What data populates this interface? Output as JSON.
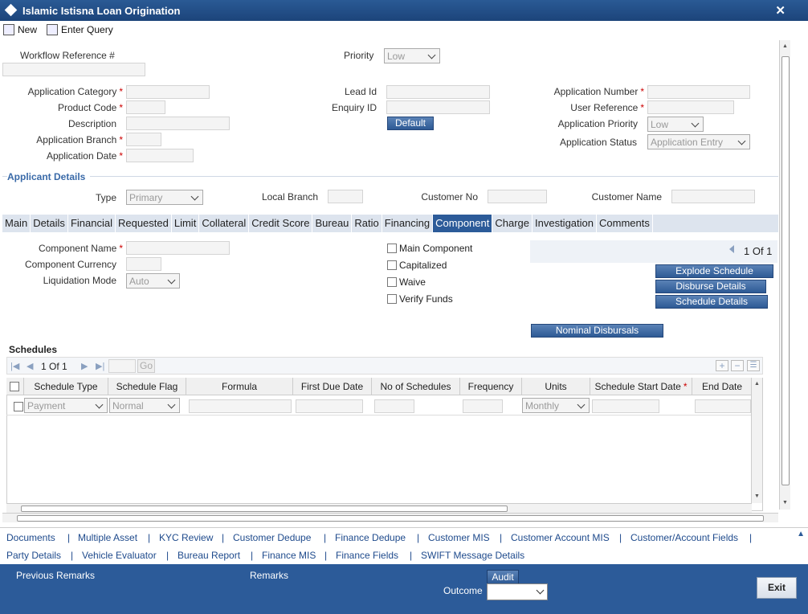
{
  "window": {
    "title": "Islamic Istisna Loan Origination",
    "close": "✕"
  },
  "toolbar": {
    "new_label": "New",
    "enter_query_label": "Enter Query"
  },
  "header": {
    "workflow_ref_label": "Workflow Reference #",
    "priority_label": "Priority",
    "priority_value": "Low"
  },
  "application": {
    "category_label": "Application Category",
    "product_code_label": "Product Code",
    "description_label": "Description",
    "branch_label": "Application Branch",
    "date_label": "Application Date",
    "lead_id_label": "Lead Id",
    "enquiry_id_label": "Enquiry ID",
    "default_button": "Default",
    "number_label": "Application Number",
    "user_ref_label": "User Reference",
    "app_priority_label": "Application Priority",
    "app_priority_value": "Low",
    "status_label": "Application Status",
    "status_value": "Application Entry"
  },
  "applicant": {
    "section_title": "Applicant Details",
    "type_label": "Type",
    "type_value": "Primary",
    "local_branch_label": "Local Branch",
    "customer_no_label": "Customer No",
    "customer_name_label": "Customer Name"
  },
  "tabs": [
    "Main",
    "Details",
    "Financial",
    "Requested",
    "Limit",
    "Collateral",
    "Credit Score",
    "Bureau",
    "Ratio",
    "Financing",
    "Component",
    "Charge",
    "Investigation",
    "Comments"
  ],
  "active_tab": "Component",
  "component": {
    "name_label": "Component Name",
    "currency_label": "Component Currency",
    "liquidation_label": "Liquidation Mode",
    "liquidation_value": "Auto",
    "main_component": "Main Component",
    "capitalized": "Capitalized",
    "waive": "Waive",
    "verify_funds": "Verify Funds",
    "pager_text": "1 Of 1",
    "explode_schedule": "Explode Schedule",
    "disburse_details": "Disburse Details",
    "schedule_details": "Schedule Details",
    "nominal_disbursals": "Nominal Disbursals"
  },
  "schedules": {
    "title": "Schedules",
    "pager_text": "1 Of 1",
    "go_label": "Go",
    "columns": [
      "Schedule Type",
      "Schedule Flag",
      "Formula",
      "First Due Date",
      "No of Schedules",
      "Frequency",
      "Units",
      "Schedule Start Date",
      "End Date"
    ],
    "row": {
      "schedule_type": "Payment",
      "schedule_flag": "Normal",
      "units": "Monthly"
    }
  },
  "links_row1": [
    "Documents",
    "Multiple Asset",
    "KYC Review",
    "Customer Dedupe",
    "Finance Dedupe",
    "Customer MIS",
    "Customer Account MIS",
    "Customer/Account Fields"
  ],
  "links_row2": [
    "Party Details",
    "Vehicle Evaluator",
    "Bureau Report",
    "Finance MIS",
    "Finance Fields",
    "SWIFT Message Details"
  ],
  "footer": {
    "previous_remarks": "Previous Remarks",
    "remarks": "Remarks",
    "audit": "Audit",
    "outcome": "Outcome",
    "exit": "Exit"
  }
}
